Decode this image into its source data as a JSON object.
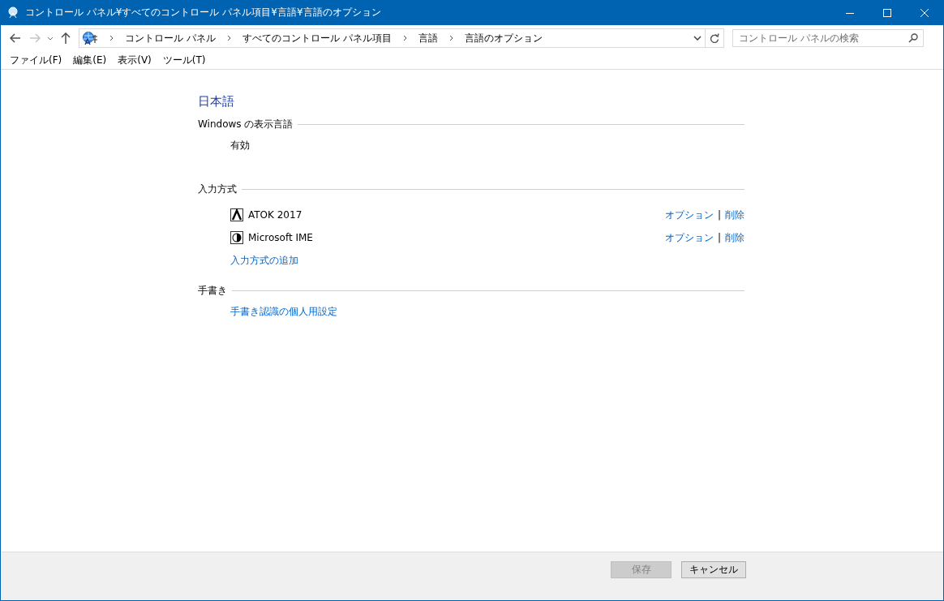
{
  "window": {
    "title": "コントロール パネル¥すべてのコントロール パネル項目¥言語¥言語のオプション"
  },
  "navigation": {
    "back": {
      "disabled": false
    },
    "forward": {
      "disabled": true
    }
  },
  "address_bar": {
    "breadcrumbs": [
      "コントロール パネル",
      "すべてのコントロール パネル項目",
      "言語",
      "言語のオプション"
    ]
  },
  "search": {
    "placeholder": "コントロール パネルの検索"
  },
  "menu": [
    "ファイル(F)",
    "編集(E)",
    "表示(V)",
    "ツール(T)"
  ],
  "language": "日本語",
  "sections": [
    {
      "heading": "Windows の表示言語",
      "kind": "status",
      "text": "有効"
    },
    {
      "heading": "入力方式",
      "kind": "methods",
      "methods": [
        {
          "name": "ATOK 2017",
          "options": "オプション",
          "separator": "|",
          "remove": "削除"
        },
        {
          "name": "Microsoft IME",
          "options": "オプション",
          "separator": "|",
          "remove": "削除"
        }
      ],
      "add_link": "入力方式の追加"
    },
    {
      "heading": "手書き",
      "kind": "links",
      "links": [
        "手書き認識の個人用設定"
      ]
    }
  ],
  "buttons": [
    {
      "label": "保存",
      "disabled": true
    },
    {
      "label": "キャンセル",
      "disabled": false
    }
  ]
}
